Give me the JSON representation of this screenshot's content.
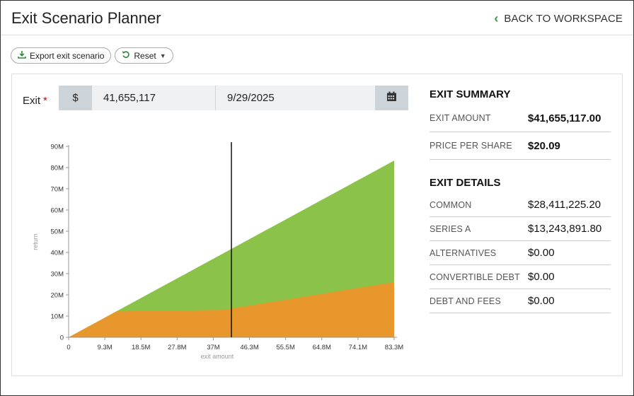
{
  "header": {
    "title": "Exit Scenario Planner",
    "back_label": "BACK TO WORKSPACE"
  },
  "toolbar": {
    "export_label": "Export exit scenario",
    "reset_label": "Reset"
  },
  "exit_form": {
    "label": "Exit",
    "required_mark": "*",
    "currency_symbol": "$",
    "amount_value": "41,655,117",
    "date_value": "9/29/2025"
  },
  "summary": {
    "title": "EXIT SUMMARY",
    "rows": [
      {
        "label": "EXIT AMOUNT",
        "value": "$41,655,117.00"
      },
      {
        "label": "PRICE PER SHARE",
        "value": "$20.09"
      }
    ]
  },
  "details": {
    "title": "EXIT DETAILS",
    "rows": [
      {
        "label": "COMMON",
        "value": "$28,411,225.20"
      },
      {
        "label": "SERIES A",
        "value": "$13,243,891.80"
      },
      {
        "label": "ALTERNATIVES",
        "value": "$0.00"
      },
      {
        "label": "CONVERTIBLE DEBT",
        "value": "$0.00"
      },
      {
        "label": "DEBT AND FEES",
        "value": "$0.00"
      }
    ]
  },
  "chart_data": {
    "type": "area",
    "xlabel": "exit amount",
    "ylabel": "return",
    "xlim": [
      0,
      83.3
    ],
    "ylim": [
      0,
      90
    ],
    "xticks": [
      "0",
      "9.3M",
      "18.5M",
      "27.8M",
      "37M",
      "46.3M",
      "55.5M",
      "64.8M",
      "74.1M",
      "83.3M"
    ],
    "yticks": [
      "0",
      "10M",
      "20M",
      "30M",
      "40M",
      "50M",
      "60M",
      "70M",
      "80M",
      "90M"
    ],
    "marker_x": 41.66,
    "series": [
      {
        "color": "#e8972c",
        "x": [
          0,
          12.2,
          39.5,
          83.3
        ],
        "y": [
          0,
          12.2,
          12.9,
          26.0
        ]
      },
      {
        "color": "#8bc34a",
        "x": [
          0,
          12.2,
          39.5,
          83.3
        ],
        "y": [
          0,
          12.2,
          39.5,
          83.3
        ]
      }
    ],
    "colors": {
      "marker": "#111111",
      "axis": "#999999",
      "tick_label": "#333333"
    }
  }
}
